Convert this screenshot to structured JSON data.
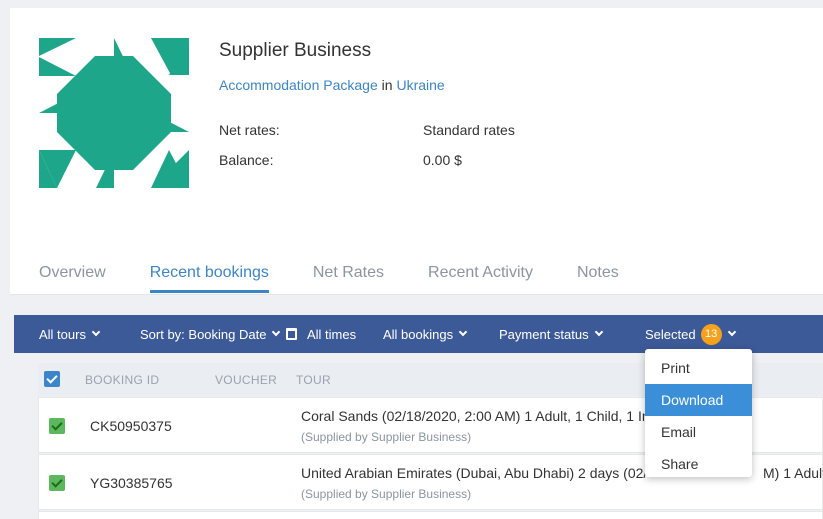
{
  "business": {
    "name": "Supplier Business",
    "package_link": "Accommodation Package",
    "in_word": "in",
    "location_link": "Ukraine",
    "net_rates_label": "Net rates:",
    "net_rates_value": "Standard rates",
    "balance_label": "Balance:",
    "balance_value": "0.00 $"
  },
  "colors": {
    "brand_teal": "#1ea68a",
    "accent_blue": "#3b86c9",
    "toolbar": "#3d5a98",
    "badge": "#f5a11c"
  },
  "tabs": [
    {
      "label": "Overview",
      "active": false
    },
    {
      "label": "Recent bookings",
      "active": true
    },
    {
      "label": "Net Rates",
      "active": false
    },
    {
      "label": "Recent Activity",
      "active": false
    },
    {
      "label": "Notes",
      "active": false
    }
  ],
  "toolbar": {
    "tours": "All tours",
    "sort": "Sort by: Booking Date",
    "times": "All times",
    "bookings": "All bookings",
    "payment": "Payment status",
    "selected": "Selected",
    "selected_count": "13"
  },
  "table": {
    "columns": [
      "BOOKING ID",
      "VOUCHER",
      "TOUR"
    ],
    "rows": [
      {
        "id": "CK50950375",
        "tour": "Coral Sands (02/18/2020, 2:00 AM) 1 Adult, 1 Child, 1 In",
        "supplier": "(Supplied by Supplier Business)"
      },
      {
        "id": "YG30385765",
        "tour": "United Arabian Emirates (Dubai, Abu Dhabi) 2 days (02/",
        "tour_end": "M) 1 Adult",
        "supplier": "(Supplied by Supplier Business)"
      }
    ]
  },
  "dropdown": {
    "items": [
      {
        "label": "Print",
        "active": false
      },
      {
        "label": "Download",
        "active": true
      },
      {
        "label": "Email",
        "active": false
      },
      {
        "label": "Share",
        "active": false
      }
    ]
  }
}
